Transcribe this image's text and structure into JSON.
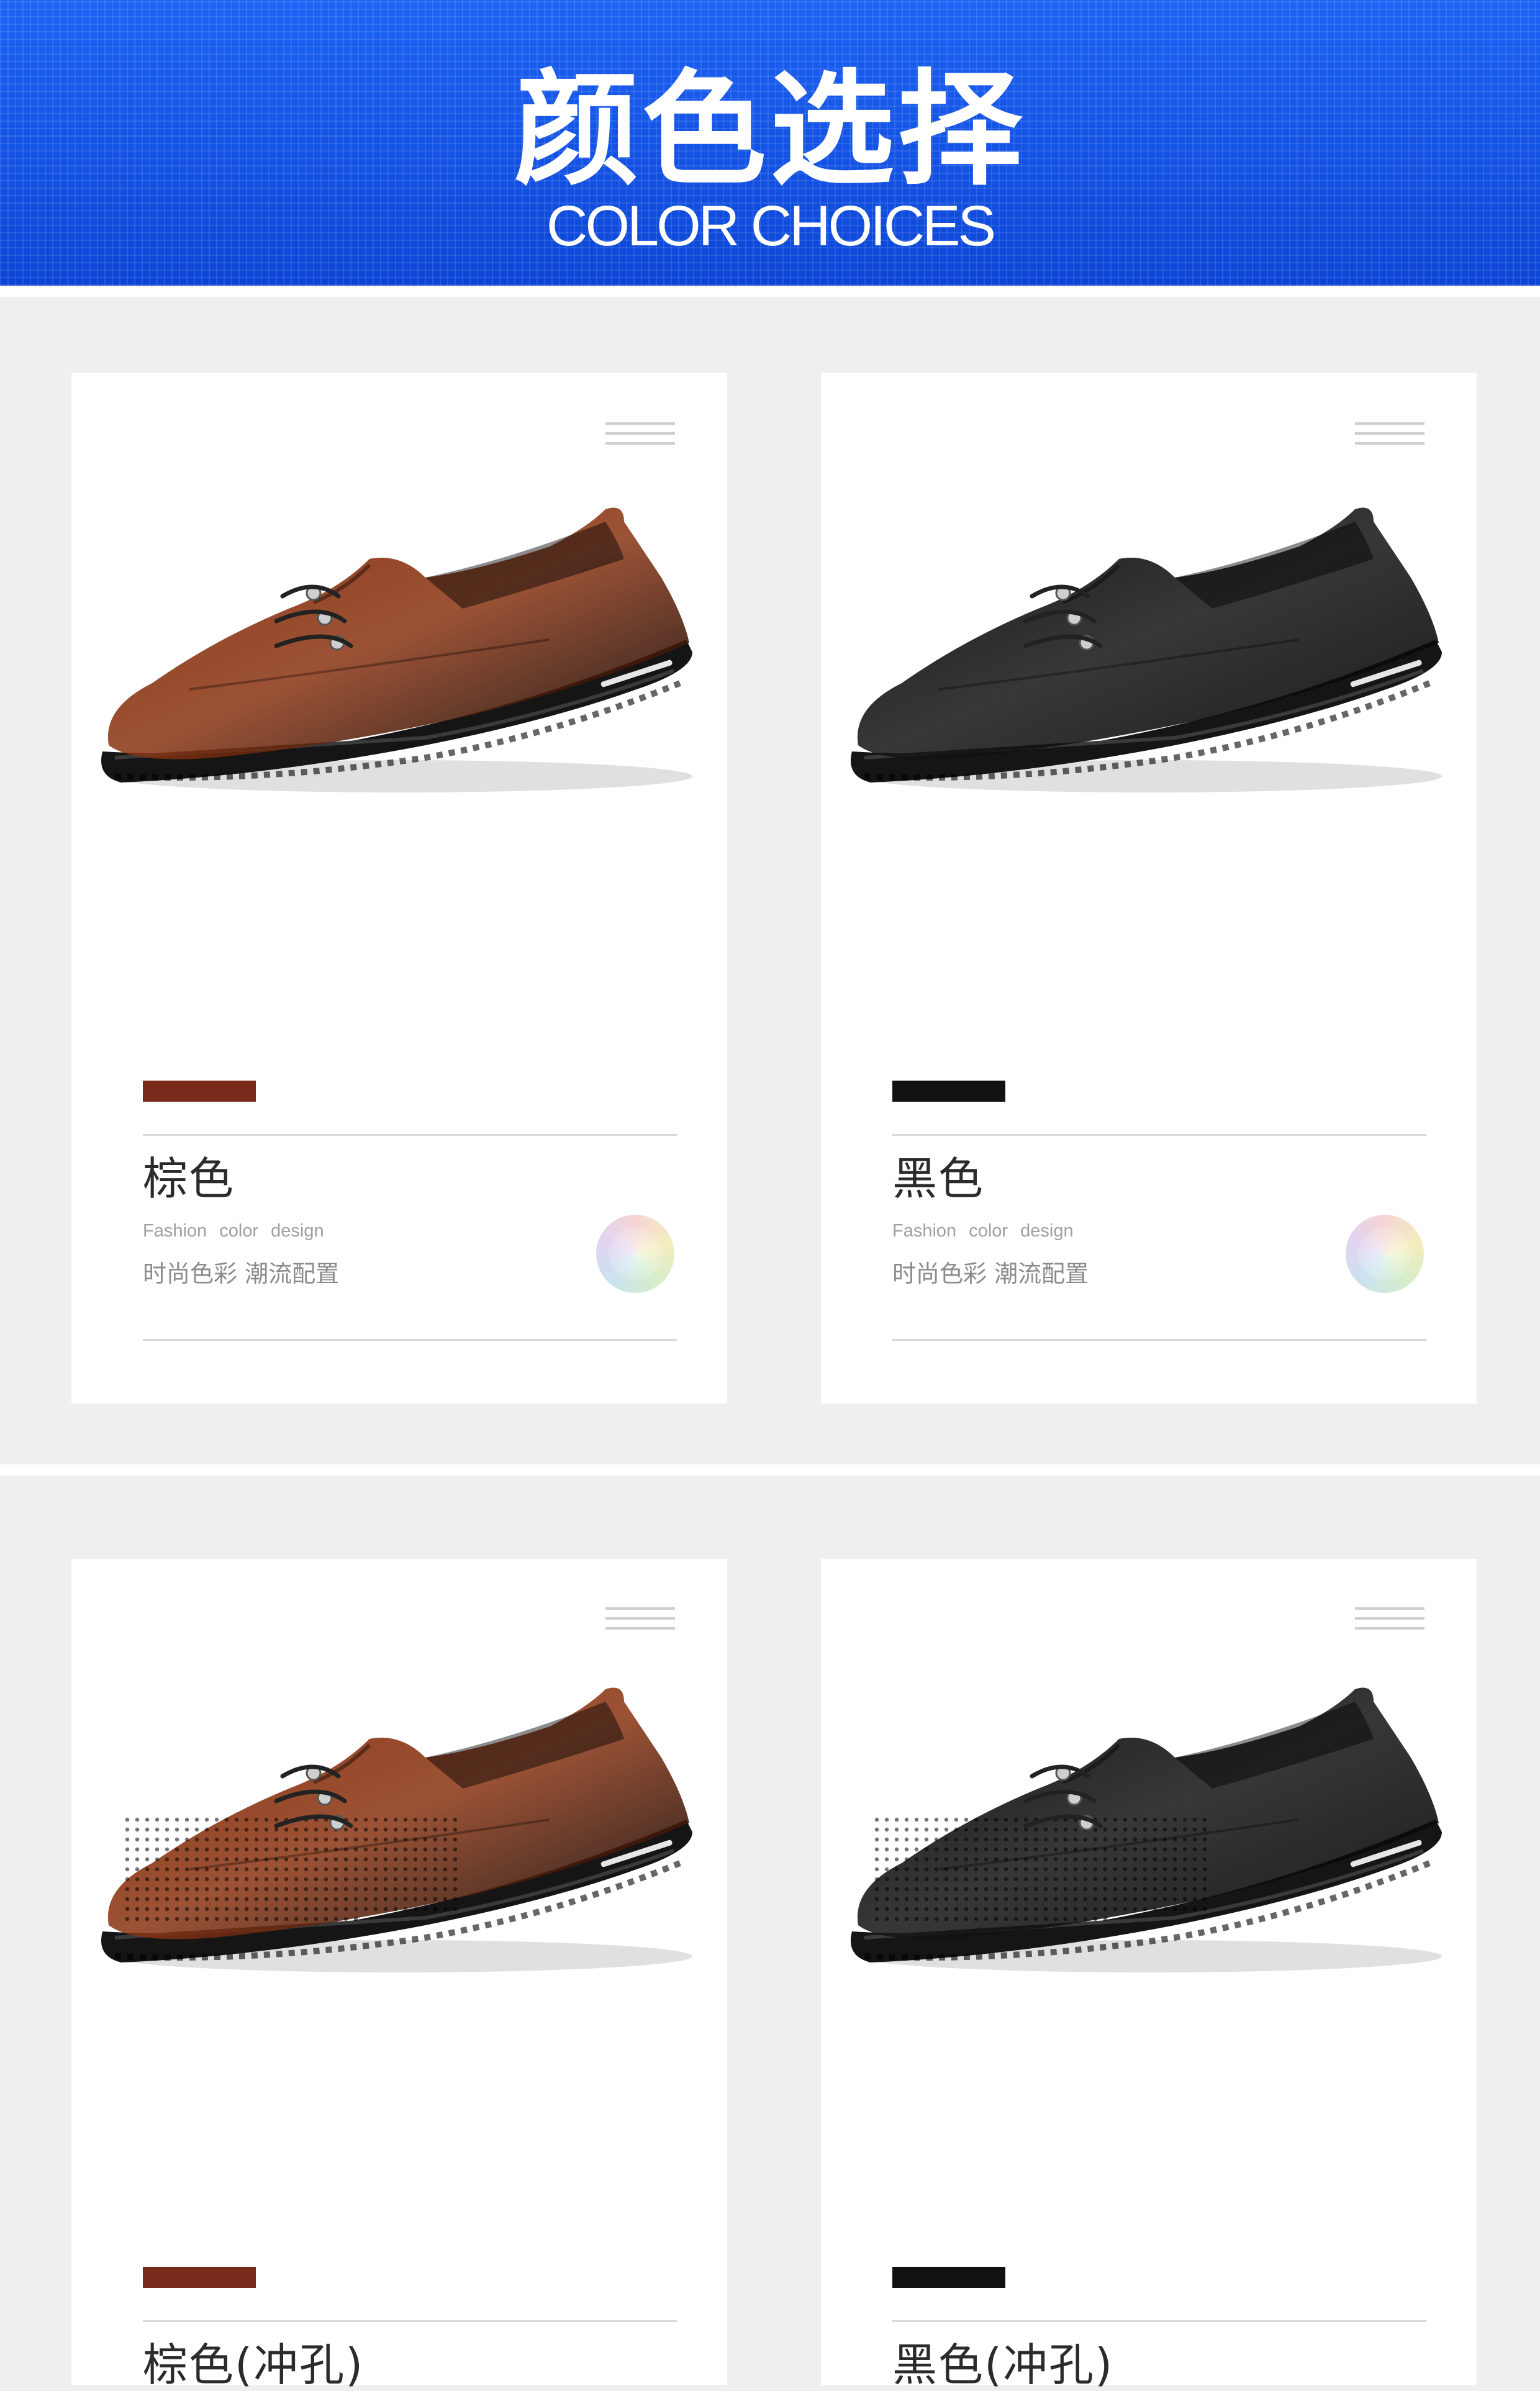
{
  "header": {
    "title": "颜色选择",
    "subtitle": "COLOR CHOICES"
  },
  "cards": [
    {
      "name": "棕色",
      "fashion": "Fashion color design",
      "tagline": "时尚色彩 潮流配置",
      "swatch_color": "#7a2a1a",
      "shoe_color": "#8a3412",
      "perforated": false
    },
    {
      "name": "黑色",
      "fashion": "Fashion color design",
      "tagline": "时尚色彩 潮流配置",
      "swatch_color": "#111111",
      "shoe_color": "#141414",
      "perforated": false
    },
    {
      "name": "棕色(冲孔)",
      "fashion": "",
      "tagline": "",
      "swatch_color": "#7a2a1a",
      "shoe_color": "#8a3412",
      "perforated": true
    },
    {
      "name": "黑色(冲孔)",
      "fashion": "",
      "tagline": "",
      "swatch_color": "#111111",
      "shoe_color": "#141414",
      "perforated": true
    }
  ],
  "colors": {
    "header_blue": "#0d4fe0",
    "brown": "#7a2a1a",
    "black": "#111111"
  }
}
